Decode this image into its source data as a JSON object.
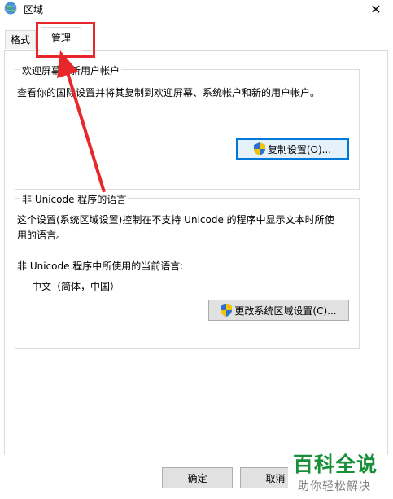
{
  "window": {
    "title": "区域",
    "close_glyph": "✕"
  },
  "tabs": [
    {
      "label": "格式",
      "active": false
    },
    {
      "label": "管理",
      "active": true
    }
  ],
  "welcome_group": {
    "legend": "欢迎屏幕和新用户帐户",
    "description": "查看你的国际设置并将其复制到欢迎屏幕、系统帐户和新的用户帐户。",
    "copy_button": "复制设置(O)..."
  },
  "unicode_group": {
    "legend": "非 Unicode 程序的语言",
    "description_line1": "这个设置(系统区域设置)控制在不支持 Unicode 的程序中显示文本时所使",
    "description_line2": "用的语言。",
    "current_label": "非 Unicode 程序中所使用的当前语言:",
    "current_value": "中文（简体，中国）",
    "change_button": "更改系统区域设置(C)..."
  },
  "footer": {
    "ok_label": "确定",
    "cancel_label": "取消"
  },
  "watermark": {
    "title": "百科全说",
    "subtitle": "助你轻松解决"
  },
  "colors": {
    "annotation": "#e8272a",
    "focus_accent": "#0078d7",
    "watermark_green": "#1a8f3a"
  },
  "icons": [
    "globe-icon",
    "close-icon",
    "uac-shield-icon"
  ]
}
